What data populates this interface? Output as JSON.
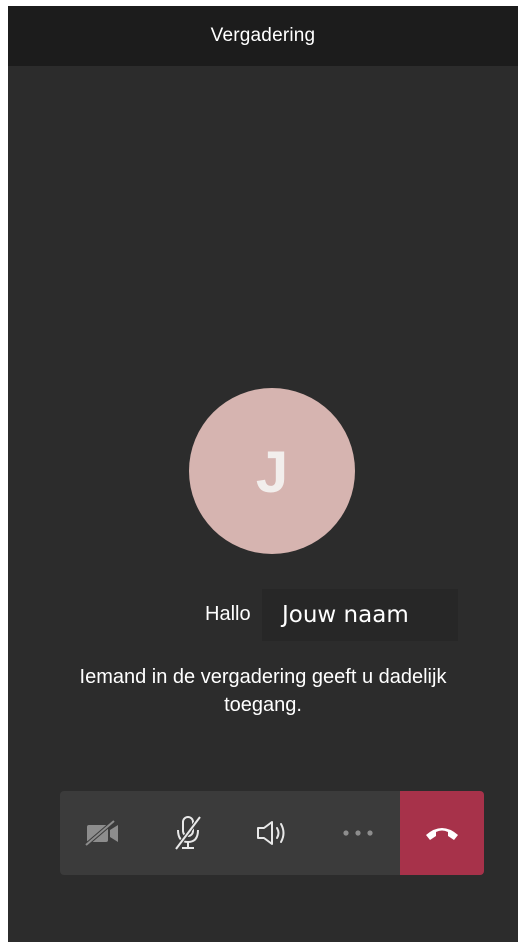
{
  "header": {
    "title": "Vergadering"
  },
  "participant": {
    "initial": "J"
  },
  "greeting": {
    "hello_label": "Hallo",
    "name_value": "Jouw naam"
  },
  "lobby": {
    "message": "Iemand in de vergadering geeft u dadelijk toegang."
  },
  "controls": {
    "items": [
      {
        "icon": "camera-off-icon",
        "state": "off"
      },
      {
        "icon": "microphone-off-icon",
        "state": "muted"
      },
      {
        "icon": "speaker-icon",
        "state": "on"
      },
      {
        "icon": "more-options-icon"
      },
      {
        "icon": "hang-up-icon"
      }
    ]
  },
  "colors": {
    "background": "#2c2c2c",
    "header": "#1c1c1c",
    "avatar": "#d6b4b0",
    "control_bar": "#3b3b3b",
    "hangup": "#a7324a"
  }
}
